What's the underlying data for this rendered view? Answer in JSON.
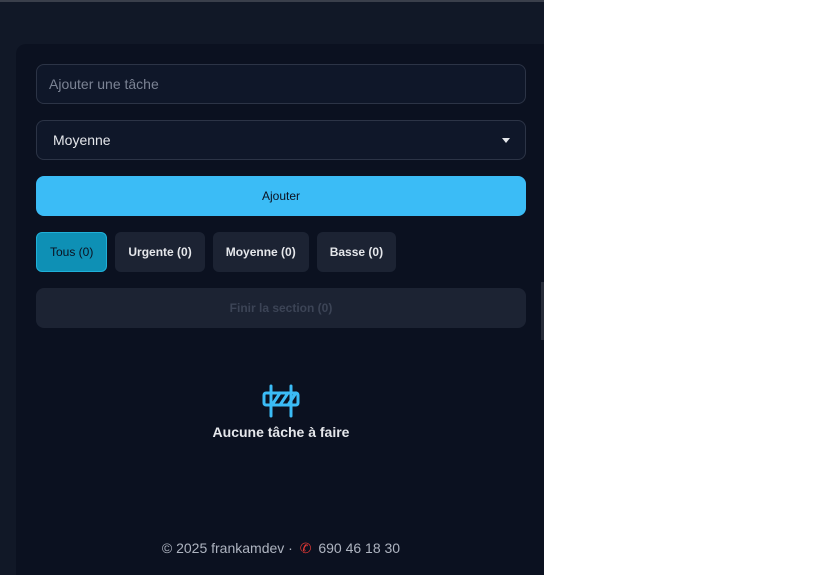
{
  "task_form": {
    "input_placeholder": "Ajouter une tâche",
    "priority_selected": "Moyenne",
    "add_label": "Ajouter"
  },
  "filters": [
    {
      "label": "Tous (0)",
      "active": true
    },
    {
      "label": "Urgente (0)",
      "active": false
    },
    {
      "label": "Moyenne (0)",
      "active": false
    },
    {
      "label": "Basse (0)",
      "active": false
    }
  ],
  "finish_label": "Finir la section (0)",
  "empty_state": {
    "icon": "barrier-icon",
    "message": "Aucune tâche à faire"
  },
  "footer": {
    "copyright": "© 2025 frankamdev ·",
    "phone_icon": "phone-icon",
    "phone": "690 46 18 30"
  },
  "colors": {
    "background": "#111827",
    "card": "#0b1120",
    "accent": "#3bbcf6",
    "active_filter": "#0e90b5",
    "phone_icon": "#e53935"
  }
}
